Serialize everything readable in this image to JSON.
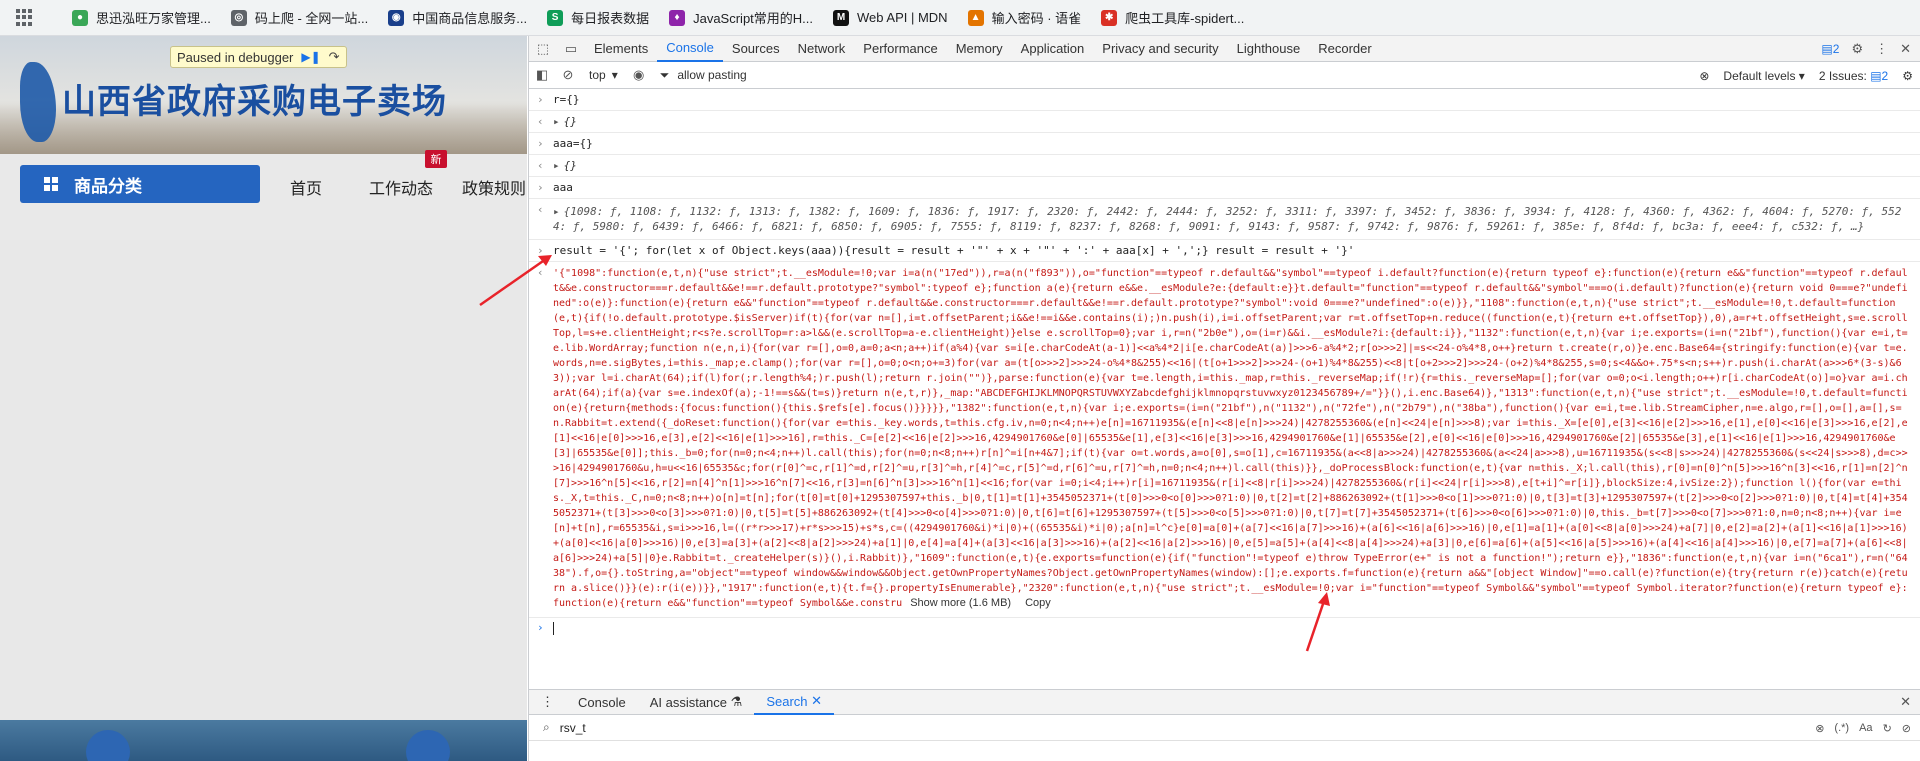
{
  "bookmarks": [
    {
      "label": "思迅泓旺万家管理...",
      "color": "#3aa757"
    },
    {
      "label": "码上爬 - 全网一站...",
      "color": "#5f6368"
    },
    {
      "label": "中国商品信息服务...",
      "color": "#1a3f8b"
    },
    {
      "label": "每日报表数据",
      "color": "#0f9d58"
    },
    {
      "label": "JavaScript常用的H...",
      "color": "#8e24aa"
    },
    {
      "label": "Web API | MDN",
      "color": "#111111"
    },
    {
      "label": "输入密码 · 语雀",
      "color": "#e37400"
    },
    {
      "label": "爬虫工具库-spidert...",
      "color": "#d93025"
    }
  ],
  "page": {
    "debug_label": "Paused in debugger",
    "site_title": "山西省政府采购电子卖场",
    "category_button": "商品分类",
    "nav": [
      "首页",
      "工作动态",
      "政策规则"
    ],
    "new_badge": "新"
  },
  "devtools": {
    "tabs": [
      "Elements",
      "Console",
      "Sources",
      "Network",
      "Performance",
      "Memory",
      "Application",
      "Privacy and security",
      "Lighthouse",
      "Recorder"
    ],
    "active_tab": "Console",
    "issues_count": "2",
    "context": "top",
    "filter_value": "allow pasting",
    "log_levels": "Default levels",
    "issues_label": "2 Issues:",
    "issues_badge": "2"
  },
  "console": {
    "r1_in": "r={}",
    "r1_out": "{}",
    "r2_in": "aaa={}",
    "r2_out": "{}",
    "r3_in": "aaa",
    "r3_out": "{1098: ƒ, 1108: ƒ, 1132: ƒ, 1313: ƒ, 1382: ƒ, 1609: ƒ, 1836: ƒ, 1917: ƒ, 2320: ƒ, 2442: ƒ, 2444: ƒ, 3252: ƒ, 3311: ƒ, 3397: ƒ, 3452: ƒ, 3836: ƒ, 3934: ƒ, 4128: ƒ, 4360: ƒ, 4362: ƒ, 4604: ƒ, 5270: ƒ, 5524: ƒ, 5980: ƒ, 6439: ƒ, 6466: ƒ, 6821: ƒ, 6850: ƒ, 6905: ƒ, 7555: ƒ, 8119: ƒ, 8237: ƒ, 8268: ƒ, 9091: ƒ, 9143: ƒ, 9587: ƒ, 9742: ƒ, 9876: ƒ, 59261: ƒ, 385e: ƒ, 8f4d: ƒ, bc3a: ƒ, eee4: ƒ, c532: ƒ, …}",
    "r4_in": "result = '{'; for(let x of Object.keys(aaa)){result = result + '\"' + x + '\"' + ':' + aaa[x] + ',';} result = result + '}'",
    "r4_out": "'{\"1098\":function(e,t,n){\"use strict\";t.__esModule=!0;var i=a(n(\"17ed\")),r=a(n(\"f893\")),o=\"function\"==typeof r.default&&\"symbol\"==typeof i.default?function(e){return typeof e}:function(e){return e&&\"function\"==typeof r.default&&e.constructor===r.default&&e!==r.default.prototype?\"symbol\":typeof e};function a(e){return e&&e.__esModule?e:{default:e}}t.default=\"function\"==typeof r.default&&\"symbol\"===o(i.default)?function(e){return void 0===e?\"undefined\":o(e)}:function(e){return e&&\"function\"==typeof r.default&&e.constructor===r.default&&e!==r.default.prototype?\"symbol\":void 0===e?\"undefined\":o(e)}},\"1108\":function(e,t,n){\"use strict\";t.__esModule=!0,t.default=function(e,t){if(!o.default.prototype.$isServer)if(t){for(var n=[],i=t.offsetParent;i&&e!==i&&e.contains(i);)n.push(i),i=i.offsetParent;var r=t.offsetTop+n.reduce((function(e,t){return e+t.offsetTop}),0),a=r+t.offsetHeight,s=e.scrollTop,l=s+e.clientHeight;r<s?e.scrollTop=r:a>l&&(e.scrollTop=a-e.clientHeight)}else e.scrollTop=0};var i,r=n(\"2b0e\"),o=(i=r)&&i.__esModule?i:{default:i}},\"1132\":function(e,t,n){var i;e.exports=(i=n(\"21bf\"),function(){var e=i,t=e.lib.WordArray;function n(e,n,i){for(var r=[],o=0,a=0;a<n;a++)if(a%4){var s=i[e.charCodeAt(a-1)]<<a%4*2|i[e.charCodeAt(a)]>>>6-a%4*2;r[o>>>2]|=s<<24-o%4*8,o++}return t.create(r,o)}e.enc.Base64={stringify:function(e){var t=e.words,n=e.sigBytes,i=this._map;e.clamp();for(var r=[],o=0;o<n;o+=3)for(var a=(t[o>>>2]>>>24-o%4*8&255)<<16|(t[o+1>>>2]>>>24-(o+1)%4*8&255)<<8|t[o+2>>>2]>>>24-(o+2)%4*8&255,s=0;s<4&&o+.75*s<n;s++)r.push(i.charAt(a>>>6*(3-s)&63));var l=i.charAt(64);if(l)for(;r.length%4;)r.push(l);return r.join(\"\")},parse:function(e){var t=e.length,i=this._map,r=this._reverseMap;if(!r){r=this._reverseMap=[];for(var o=0;o<i.length;o++)r[i.charCodeAt(o)]=o}var a=i.charAt(64);if(a){var s=e.indexOf(a);-1!==s&&(t=s)}return n(e,t,r)},_map:\"ABCDEFGHIJKLMNOPQRSTUVWXYZabcdefghijklmnopqrstuvwxyz0123456789+/=\"}}(),i.enc.Base64)},\"1313\":function(e,t,n){\"use strict\";t.__esModule=!0,t.default=function(e){return{methods:{focus:function(){this.$refs[e].focus()}}}}},\"1382\":function(e,t,n){var i;e.exports=(i=n(\"21bf\"),n(\"1132\"),n(\"72fe\"),n(\"2b79\"),n(\"38ba\"),function(){var e=i,t=e.lib.StreamCipher,n=e.algo,r=[],o=[],a=[],s=n.Rabbit=t.extend({_doReset:function(){for(var e=this._key.words,t=this.cfg.iv,n=0;n<4;n++)e[n]=16711935&(e[n]<<8|e[n]>>>24)|4278255360&(e[n]<<24|e[n]>>>8);var i=this._X=[e[0],e[3]<<16|e[2]>>>16,e[1],e[0]<<16|e[3]>>>16,e[2],e[1]<<16|e[0]>>>16,e[3],e[2]<<16|e[1]>>>16],r=this._C=[e[2]<<16|e[2]>>>16,4294901760&e[0]|65535&e[1],e[3]<<16|e[3]>>>16,4294901760&e[1]|65535&e[2],e[0]<<16|e[0]>>>16,4294901760&e[2]|65535&e[3],e[1]<<16|e[1]>>>16,4294901760&e[3]|65535&e[0]];this._b=0;for(n=0;n<4;n++)l.call(this);for(n=0;n<8;n++)r[n]^=i[n+4&7];if(t){var o=t.words,a=o[0],s=o[1],c=16711935&(a<<8|a>>>24)|4278255360&(a<<24|a>>>8),u=16711935&(s<<8|s>>>24)|4278255360&(s<<24|s>>>8),d=c>>>16|4294901760&u,h=u<<16|65535&c;for(r[0]^=c,r[1]^=d,r[2]^=u,r[3]^=h,r[4]^=c,r[5]^=d,r[6]^=u,r[7]^=h,n=0;n<4;n++)l.call(this)}},_doProcessBlock:function(e,t){var n=this._X;l.call(this),r[0]=n[0]^n[5]>>>16^n[3]<<16,r[1]=n[2]^n[7]>>>16^n[5]<<16,r[2]=n[4]^n[1]>>>16^n[7]<<16,r[3]=n[6]^n[3]>>>16^n[1]<<16;for(var i=0;i<4;i++)r[i]=16711935&(r[i]<<8|r[i]>>>24)|4278255360&(r[i]<<24|r[i]>>>8),e[t+i]^=r[i]},blockSize:4,ivSize:2});function l(){for(var e=this._X,t=this._C,n=0;n<8;n++)o[n]=t[n];for(t[0]=t[0]+1295307597+this._b|0,t[1]=t[1]+3545052371+(t[0]>>>0<o[0]>>>0?1:0)|0,t[2]=t[2]+886263092+(t[1]>>>0<o[1]>>>0?1:0)|0,t[3]=t[3]+1295307597+(t[2]>>>0<o[2]>>>0?1:0)|0,t[4]=t[4]+3545052371+(t[3]>>>0<o[3]>>>0?1:0)|0,t[5]=t[5]+886263092+(t[4]>>>0<o[4]>>>0?1:0)|0,t[6]=t[6]+1295307597+(t[5]>>>0<o[5]>>>0?1:0)|0,t[7]=t[7]+3545052371+(t[6]>>>0<o[6]>>>0?1:0)|0,this._b=t[7]>>>0<o[7]>>>0?1:0,n=0;n<8;n++){var i=e[n]+t[n],r=65535&i,s=i>>>16,l=((r*r>>>17)+r*s>>>15)+s*s,c=((4294901760&i)*i|0)+((65535&i)*i|0);a[n]=l^c}e[0]=a[0]+(a[7]<<16|a[7]>>>16)+(a[6]<<16|a[6]>>>16)|0,e[1]=a[1]+(a[0]<<8|a[0]>>>24)+a[7]|0,e[2]=a[2]+(a[1]<<16|a[1]>>>16)+(a[0]<<16|a[0]>>>16)|0,e[3]=a[3]+(a[2]<<8|a[2]>>>24)+a[1]|0,e[4]=a[4]+(a[3]<<16|a[3]>>>16)+(a[2]<<16|a[2]>>>16)|0,e[5]=a[5]+(a[4]<<8|a[4]>>>24)+a[3]|0,e[6]=a[6]+(a[5]<<16|a[5]>>>16)+(a[4]<<16|a[4]>>>16)|0,e[7]=a[7]+(a[6]<<8|a[6]>>>24)+a[5]|0}e.Rabbit=t._createHelper(s)}(),i.Rabbit)},\"1609\":function(e,t){e.exports=function(e){if(\"function\"!=typeof e)throw TypeError(e+\" is not a function!\");return e}},\"1836\":function(e,t,n){var i=n(\"6ca1\"),r=n(\"6438\").f,o={}.toString,a=\"object\"==typeof window&&window&&Object.getOwnPropertyNames?Object.getOwnPropertyNames(window):[];e.exports.f=function(e){return a&&\"[object Window]\"==o.call(e)?function(e){try{return r(e)}catch(e){return a.slice()}}(e):r(i(e))}},\"1917\":function(e,t){t.f={}.propertyIsEnumerable},\"2320\":function(e,t,n){\"use strict\";t.__esModule=!0;var i=\"function\"==typeof Symbol&&\"symbol\"==typeof Symbol.iterator?function(e){return typeof e}:function(e){return e&&\"function\"==typeof Symbol&&e.constru",
    "show_more": "Show more (1.6 MB)",
    "copy": "Copy"
  },
  "drawer": {
    "tabs": [
      "Console",
      "AI assistance",
      "Search"
    ],
    "active_tab": "Search",
    "search_value": "rsv_t",
    "aa": "Aa",
    "regex": "(.*)"
  },
  "colors": {
    "accent": "#1a73e8",
    "string_red": "#c41a16",
    "brand_blue": "#2565c0",
    "arrow_red": "#e8232a"
  }
}
